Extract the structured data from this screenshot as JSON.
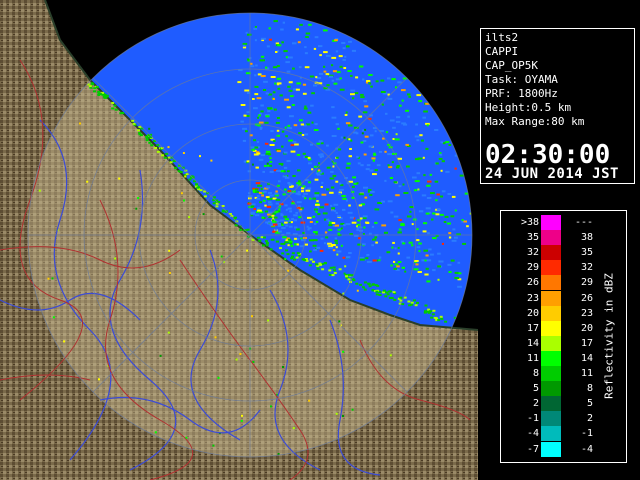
{
  "info": {
    "station": "ilts2",
    "product": "CAPPI",
    "scan": "CAP_OP5K",
    "task": "Task: OYAMA",
    "prf": "PRF: 1800Hz",
    "height": "Height:0.5 km",
    "max_range": "Max Range:80 km",
    "time": "02:30:00",
    "date": "24 JUN 2014 JST"
  },
  "legend": {
    "title": "Reflectivity in dBZ",
    "rows": [
      {
        "left": ">38",
        "right": "---",
        "color": "#ff00ff"
      },
      {
        "left": "35",
        "right": "38",
        "color": "#ee0088"
      },
      {
        "left": "32",
        "right": "35",
        "color": "#cc0000"
      },
      {
        "left": "29",
        "right": "32",
        "color": "#ff2a00"
      },
      {
        "left": "26",
        "right": "29",
        "color": "#ff7700"
      },
      {
        "left": "23",
        "right": "26",
        "color": "#ff9f00"
      },
      {
        "left": "20",
        "right": "23",
        "color": "#ffcc00"
      },
      {
        "left": "17",
        "right": "20",
        "color": "#ffff00"
      },
      {
        "left": "14",
        "right": "17",
        "color": "#aaff00"
      },
      {
        "left": "11",
        "right": "14",
        "color": "#00ff00"
      },
      {
        "left": "8",
        "right": "11",
        "color": "#00cc00"
      },
      {
        "left": "5",
        "right": "8",
        "color": "#009900"
      },
      {
        "left": "2",
        "right": "5",
        "color": "#006633"
      },
      {
        "left": "-1",
        "right": "2",
        "color": "#008877"
      },
      {
        "left": "-4",
        "right": "-1",
        "color": "#00bbbb"
      },
      {
        "left": "-7",
        "right": "-4",
        "color": "#00ffff"
      }
    ]
  },
  "map": {
    "sea_color": "#1f5cff",
    "sea_echo_color": "#2a7cff",
    "land_color": "#7a6a4a",
    "land_dark_color": "#4e3f28",
    "land_in_range_color": "#b0a080",
    "river_color": "#3b4bd6",
    "boundary_color": "#b03030",
    "range_ring_color": "#6a7a9a"
  }
}
